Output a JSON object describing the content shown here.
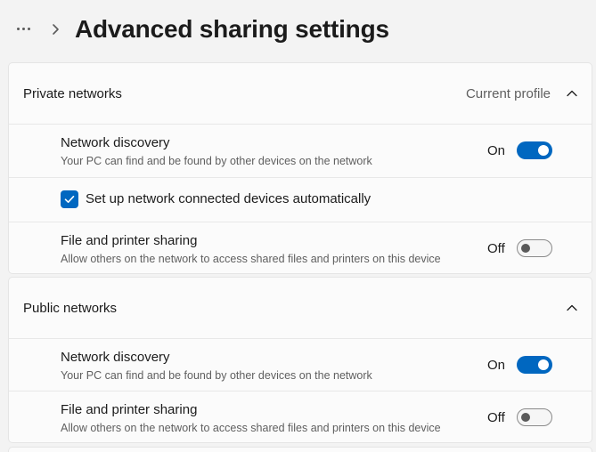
{
  "header": {
    "breadcrumb_more": "...",
    "title": "Advanced sharing settings"
  },
  "private": {
    "title": "Private networks",
    "badge": "Current profile",
    "network_discovery": {
      "title": "Network discovery",
      "desc": "Your PC can find and be found by other devices on the network",
      "state": "On",
      "value": true
    },
    "auto_setup": {
      "label": "Set up network connected devices automatically",
      "checked": true
    },
    "file_sharing": {
      "title": "File and printer sharing",
      "desc": "Allow others on the network to access shared files and printers on this device",
      "state": "Off",
      "value": false
    }
  },
  "public": {
    "title": "Public networks",
    "network_discovery": {
      "title": "Network discovery",
      "desc": "Your PC can find and be found by other devices on the network",
      "state": "On",
      "value": true
    },
    "file_sharing": {
      "title": "File and printer sharing",
      "desc": "Allow others on the network to access shared files and printers on this device",
      "state": "Off",
      "value": false
    }
  },
  "colors": {
    "accent": "#0067c0",
    "background": "#f3f3f3",
    "card": "#fbfbfb"
  }
}
